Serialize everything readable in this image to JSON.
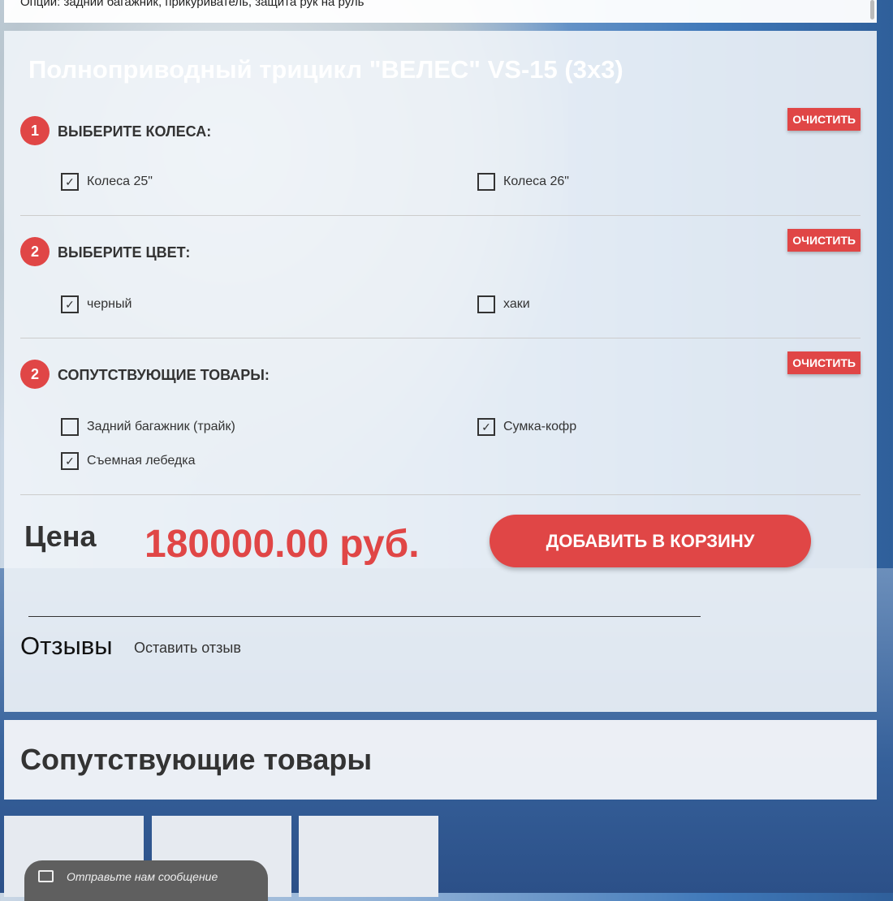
{
  "top_text": "Опции: задний багажник, прикуриватель, защита рук на руль",
  "product_title": "Полноприводный трицикл \"ВЕЛЕС\" VS-15 (3x3)",
  "sections": [
    {
      "num": "1",
      "title": "ВЫБЕРИТЕ КОЛЕСА:",
      "clear": "ОЧИСТИТЬ",
      "options": [
        {
          "label": "Колеса 25\"",
          "checked": true
        },
        {
          "label": "Колеса 26\"",
          "checked": false
        }
      ]
    },
    {
      "num": "2",
      "title": "ВЫБЕРИТЕ ЦВЕТ:",
      "clear": "ОЧИСТИТЬ",
      "options": [
        {
          "label": "черный",
          "checked": true
        },
        {
          "label": "хаки",
          "checked": false
        }
      ]
    },
    {
      "num": "2",
      "title": "СОПУТСТВУЮЩИЕ ТОВАРЫ:",
      "clear": "ОЧИСТИТЬ",
      "options": [
        {
          "label": "Задний багажник (трайк)",
          "checked": false
        },
        {
          "label": "Сумка-кофр",
          "checked": true
        },
        {
          "label": "Съемная лебедка",
          "checked": true
        }
      ]
    }
  ],
  "price_label": "Цена",
  "price": "180000.00 руб.",
  "cart_button": "ДОБАВИТЬ В КОРЗИНУ",
  "reviews_title": "Отзывы",
  "reviews_link": "Оставить отзыв",
  "related_title": "Сопутствующие товары",
  "chat_label": "Отправьте нам сообщение",
  "colors": {
    "accent": "#e04646"
  }
}
